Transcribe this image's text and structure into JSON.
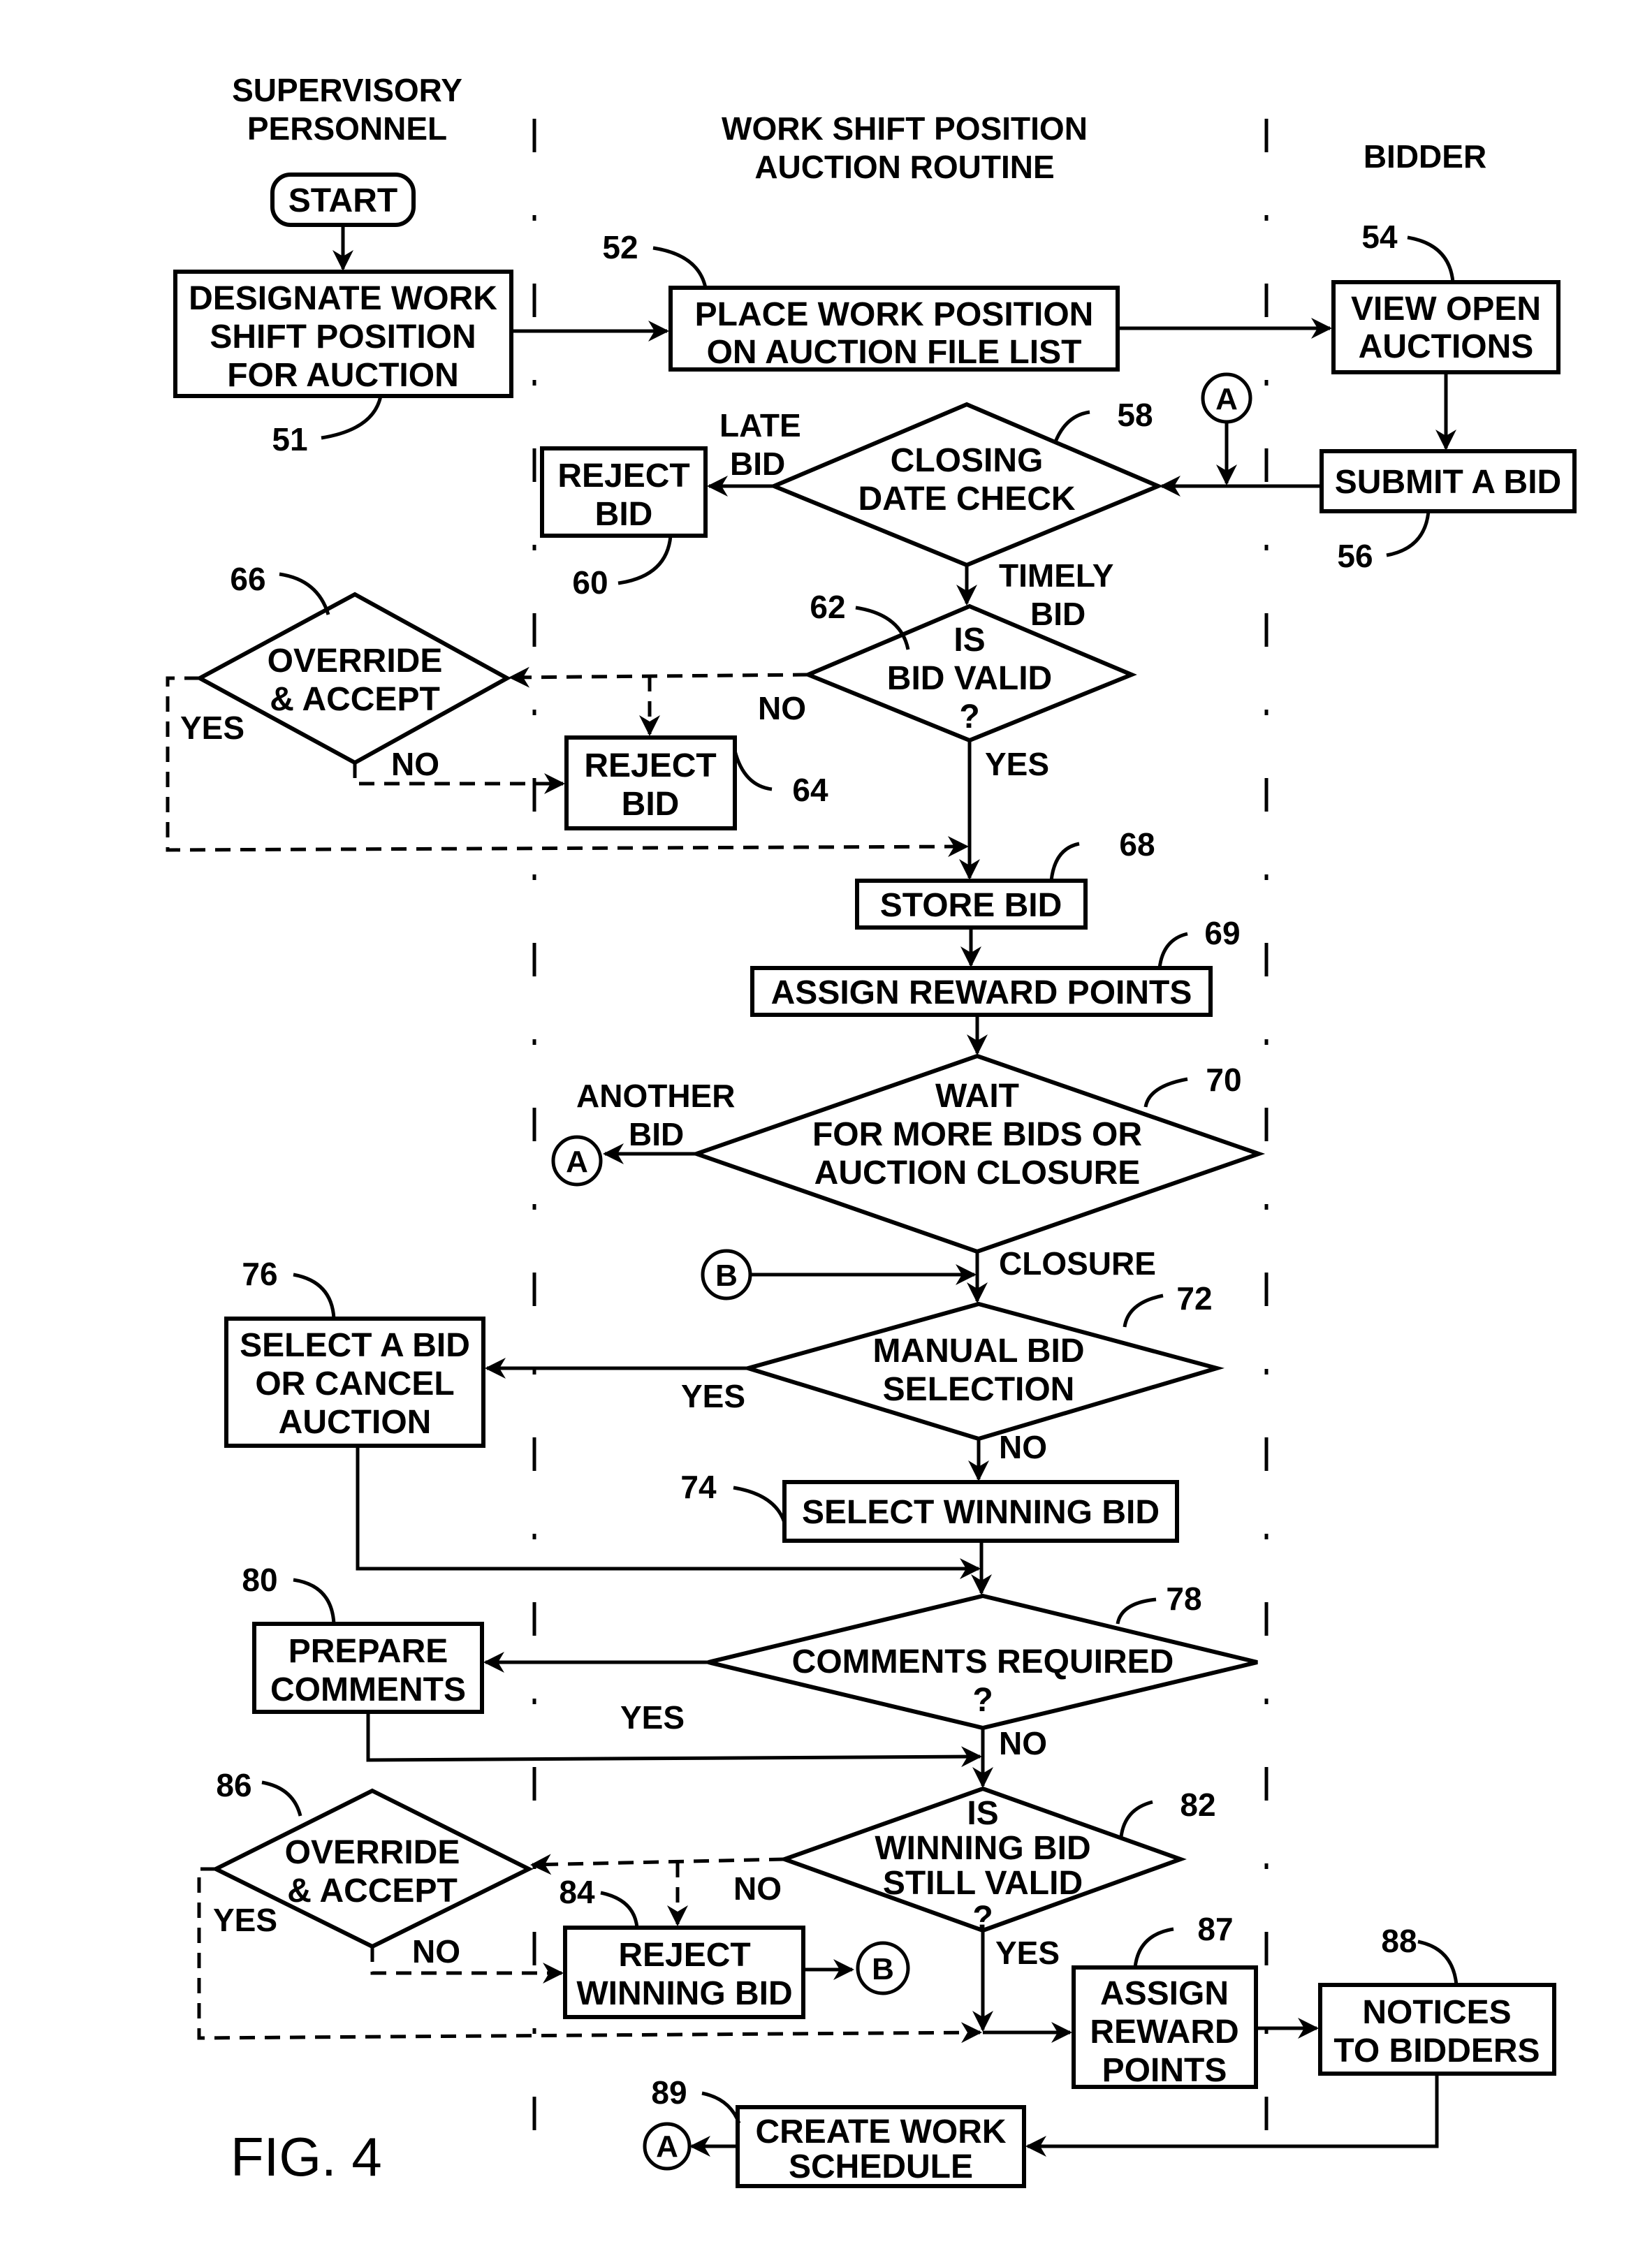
{
  "figure_label": "FIG. 4",
  "lanes": {
    "supervisory": [
      "SUPERVISORY",
      "PERSONNEL"
    ],
    "routine": [
      "WORK SHIFT POSITION",
      "AUCTION ROUTINE"
    ],
    "bidder": [
      "BIDDER"
    ]
  },
  "nodes": {
    "start": {
      "text": [
        "START"
      ]
    },
    "n51": {
      "ref": "51",
      "text": [
        "DESIGNATE WORK",
        "SHIFT POSITION",
        "FOR AUCTION"
      ]
    },
    "n52": {
      "ref": "52",
      "text": [
        "PLACE WORK POSITION",
        "ON AUCTION FILE LIST"
      ]
    },
    "n54": {
      "ref": "54",
      "text": [
        "VIEW OPEN",
        "AUCTIONS"
      ]
    },
    "n56": {
      "ref": "56",
      "text": [
        "SUBMIT A BID"
      ]
    },
    "n58": {
      "ref": "58",
      "text": [
        "CLOSING",
        "DATE CHECK"
      ]
    },
    "n60": {
      "ref": "60",
      "text": [
        "REJECT",
        "BID"
      ]
    },
    "n62": {
      "ref": "62",
      "text": [
        "IS",
        "BID VALID",
        "?"
      ]
    },
    "n64": {
      "ref": "64",
      "text": [
        "REJECT",
        "BID"
      ]
    },
    "n66": {
      "ref": "66",
      "text": [
        "OVERRIDE",
        "& ACCEPT"
      ]
    },
    "n68": {
      "ref": "68",
      "text": [
        "STORE BID"
      ]
    },
    "n69": {
      "ref": "69",
      "text": [
        "ASSIGN REWARD POINTS"
      ]
    },
    "n70": {
      "ref": "70",
      "text": [
        "WAIT",
        "FOR MORE BIDS OR",
        "AUCTION CLOSURE"
      ]
    },
    "n72": {
      "ref": "72",
      "text": [
        "MANUAL BID",
        "SELECTION"
      ]
    },
    "n74": {
      "ref": "74",
      "text": [
        "SELECT WINNING BID"
      ]
    },
    "n76": {
      "ref": "76",
      "text": [
        "SELECT A BID",
        "OR CANCEL",
        "AUCTION"
      ]
    },
    "n78": {
      "ref": "78",
      "text": [
        "COMMENTS REQUIRED",
        "?"
      ]
    },
    "n80": {
      "ref": "80",
      "text": [
        "PREPARE",
        "COMMENTS"
      ]
    },
    "n82": {
      "ref": "82",
      "text": [
        "IS",
        "WINNING BID",
        "STILL VALID",
        "?"
      ]
    },
    "n84": {
      "ref": "84",
      "text": [
        "REJECT",
        "WINNING BID"
      ]
    },
    "n86": {
      "ref": "86",
      "text": [
        "OVERRIDE",
        "& ACCEPT"
      ]
    },
    "n87": {
      "ref": "87",
      "text": [
        "ASSIGN",
        "REWARD",
        "POINTS"
      ]
    },
    "n88": {
      "ref": "88",
      "text": [
        "NOTICES",
        "TO BIDDERS"
      ]
    },
    "n89": {
      "ref": "89",
      "text": [
        "CREATE WORK",
        "SCHEDULE"
      ]
    }
  },
  "connectors": {
    "a": "A",
    "b": "B"
  },
  "edge_labels": {
    "late_bid": [
      "LATE",
      "BID"
    ],
    "timely_bid": [
      "TIMELY",
      "BID"
    ],
    "valid_no": "NO",
    "valid_yes": "YES",
    "ovr1_yes": "YES",
    "ovr1_no": "NO",
    "another_bid": [
      "ANOTHER",
      "BID"
    ],
    "closure": "CLOSURE",
    "manual_yes": "YES",
    "manual_no": "NO",
    "comments_yes": "YES",
    "comments_no": "NO",
    "still_valid_no": "NO",
    "still_valid_yes": "YES",
    "ovr2_yes": "YES",
    "ovr2_no": "NO"
  }
}
